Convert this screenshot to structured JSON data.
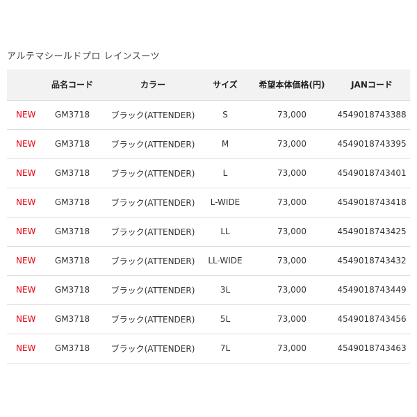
{
  "page": {
    "title": "アルテマシールドプロ レインスーツ"
  },
  "table": {
    "headers": [
      "",
      "品名コード",
      "カラー",
      "サイズ",
      "希望本体価格(円)",
      "JANコード"
    ],
    "rows": [
      {
        "badge": "NEW",
        "code": "GM3718",
        "color": "ブラック(ATTENDER)",
        "size": "S",
        "price": "73,000",
        "jan": "4549018743388"
      },
      {
        "badge": "NEW",
        "code": "GM3718",
        "color": "ブラック(ATTENDER)",
        "size": "M",
        "price": "73,000",
        "jan": "4549018743395"
      },
      {
        "badge": "NEW",
        "code": "GM3718",
        "color": "ブラック(ATTENDER)",
        "size": "L",
        "price": "73,000",
        "jan": "4549018743401"
      },
      {
        "badge": "NEW",
        "code": "GM3718",
        "color": "ブラック(ATTENDER)",
        "size": "L-WIDE",
        "price": "73,000",
        "jan": "4549018743418"
      },
      {
        "badge": "NEW",
        "code": "GM3718",
        "color": "ブラック(ATTENDER)",
        "size": "LL",
        "price": "73,000",
        "jan": "4549018743425"
      },
      {
        "badge": "NEW",
        "code": "GM3718",
        "color": "ブラック(ATTENDER)",
        "size": "LL-WIDE",
        "price": "73,000",
        "jan": "4549018743432"
      },
      {
        "badge": "NEW",
        "code": "GM3718",
        "color": "ブラック(ATTENDER)",
        "size": "3L",
        "price": "73,000",
        "jan": "4549018743449"
      },
      {
        "badge": "NEW",
        "code": "GM3718",
        "color": "ブラック(ATTENDER)",
        "size": "5L",
        "price": "73,000",
        "jan": "4549018743456"
      },
      {
        "badge": "NEW",
        "code": "GM3718",
        "color": "ブラック(ATTENDER)",
        "size": "7L",
        "price": "73,000",
        "jan": "4549018743463"
      }
    ]
  },
  "colors": {
    "badge": "#e60012",
    "header_bg": "#f2f2f2",
    "divider": "#dddddd"
  }
}
